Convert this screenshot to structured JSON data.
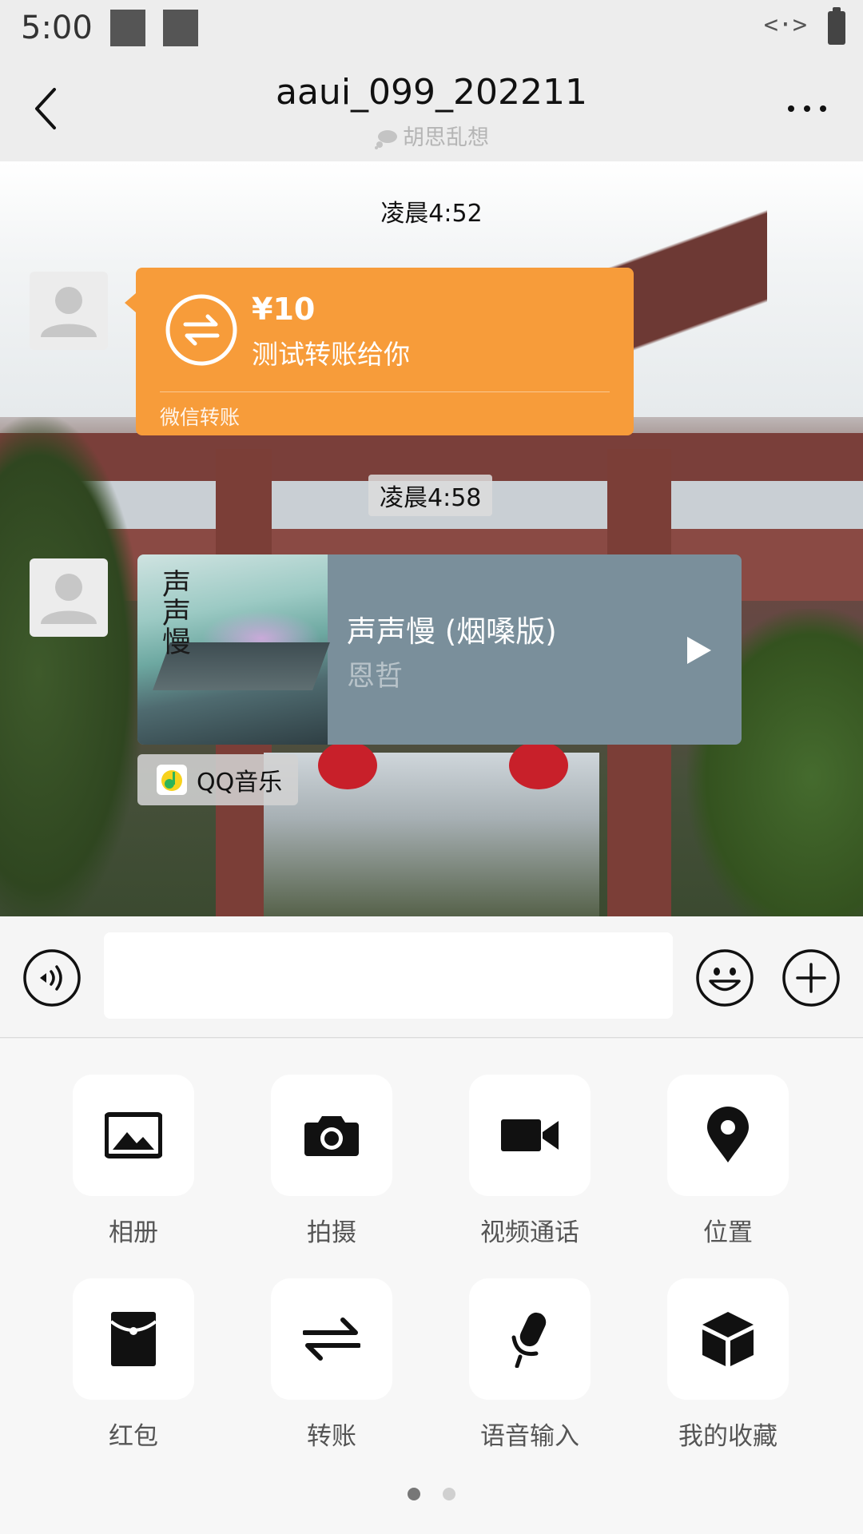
{
  "status_bar": {
    "time": "5:00",
    "network_glyph": "<·>"
  },
  "nav": {
    "title": "aaui_099_202211",
    "subtitle": "胡思乱想"
  },
  "chat": {
    "time_1": "凌晨4:52",
    "time_2": "凌晨4:58",
    "transfer": {
      "amount": "¥10",
      "description": "测试转账给你",
      "footer": "微信转账",
      "color": "#f79c3a"
    },
    "music": {
      "cover_text": "声声慢",
      "title": "声声慢 (烟嗓版)",
      "artist": "恩哲",
      "source": "QQ音乐",
      "color": "#7a8f9b"
    }
  },
  "input": {
    "value": "",
    "placeholder": ""
  },
  "actions": [
    {
      "label": "相册",
      "icon": "photo-album-icon"
    },
    {
      "label": "拍摄",
      "icon": "camera-icon"
    },
    {
      "label": "视频通话",
      "icon": "video-call-icon"
    },
    {
      "label": "位置",
      "icon": "location-pin-icon"
    },
    {
      "label": "红包",
      "icon": "red-packet-icon"
    },
    {
      "label": "转账",
      "icon": "transfer-icon"
    },
    {
      "label": "语音输入",
      "icon": "microphone-icon"
    },
    {
      "label": "我的收藏",
      "icon": "favorites-box-icon"
    }
  ],
  "pagination": {
    "current": 1,
    "total": 2
  }
}
